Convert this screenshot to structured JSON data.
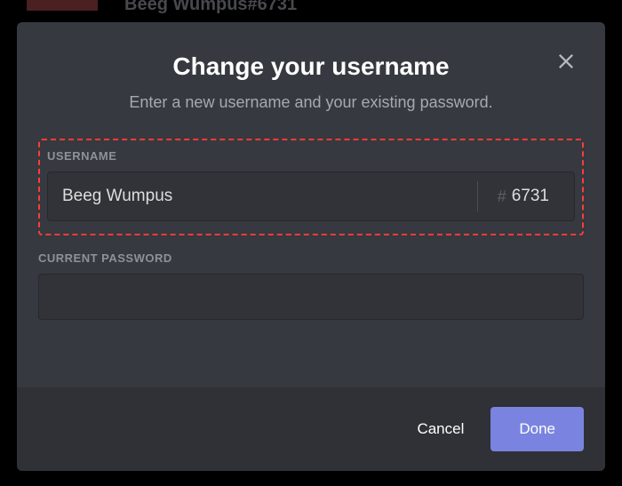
{
  "backdrop": {
    "username_hint": "Beeg Wumpus#6731"
  },
  "modal": {
    "title": "Change your username",
    "subtitle": "Enter a new username and your existing password.",
    "username_label": "USERNAME",
    "username_value": "Beeg Wumpus",
    "discriminator_hash": "#",
    "discriminator_value": "6731",
    "password_label": "CURRENT PASSWORD",
    "password_value": "",
    "cancel_label": "Cancel",
    "done_label": "Done"
  }
}
